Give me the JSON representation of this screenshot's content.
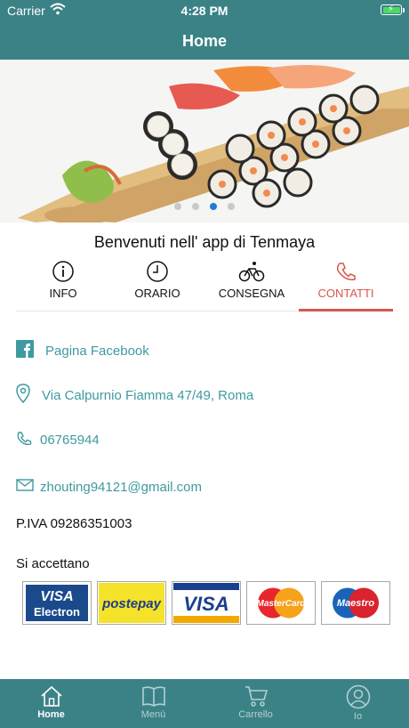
{
  "status_bar": {
    "carrier": "Carrier",
    "time": "4:28 PM"
  },
  "nav": {
    "title": "Home"
  },
  "banner": {
    "dots": 4,
    "active_dot": 3
  },
  "welcome": "Benvenuti nell' app di Tenmaya",
  "tabs": [
    {
      "label": "INFO",
      "icon": "info-icon",
      "active": false
    },
    {
      "label": "ORARIO",
      "icon": "clock-icon",
      "active": false
    },
    {
      "label": "CONSEGNA",
      "icon": "bicycle-icon",
      "active": false
    },
    {
      "label": "CONTATTI",
      "icon": "phone-icon",
      "active": true
    }
  ],
  "contacts": {
    "facebook": "Pagina Facebook",
    "address": "Via Calpurnio Fiamma 47/49, Roma",
    "phone": "06765944",
    "email": "zhouting94121@gmail.com"
  },
  "piva": "P.IVA 09286351003",
  "accepted_label": "Si accettano",
  "payment_cards": [
    {
      "name": "visa-electron-card",
      "line1": "VISA",
      "line2": "Electron"
    },
    {
      "name": "postepay-card",
      "line1": "postepay"
    },
    {
      "name": "visa-card",
      "line1": "VISA"
    },
    {
      "name": "mastercard-card",
      "line1": "MasterCard"
    },
    {
      "name": "maestro-card",
      "line1": "Maestro"
    }
  ],
  "bottom_tabs": [
    {
      "label": "Home",
      "icon": "home-icon",
      "active": true
    },
    {
      "label": "Menù",
      "icon": "book-icon",
      "active": false
    },
    {
      "label": "Carrello",
      "icon": "cart-icon",
      "active": false
    },
    {
      "label": "Io",
      "icon": "user-icon",
      "active": false
    }
  ],
  "colors": {
    "primary": "#3b8287",
    "accent": "#d6574b",
    "link": "#3e9aa0",
    "battery": "#4cd964",
    "dot_active": "#1f7ad8"
  }
}
